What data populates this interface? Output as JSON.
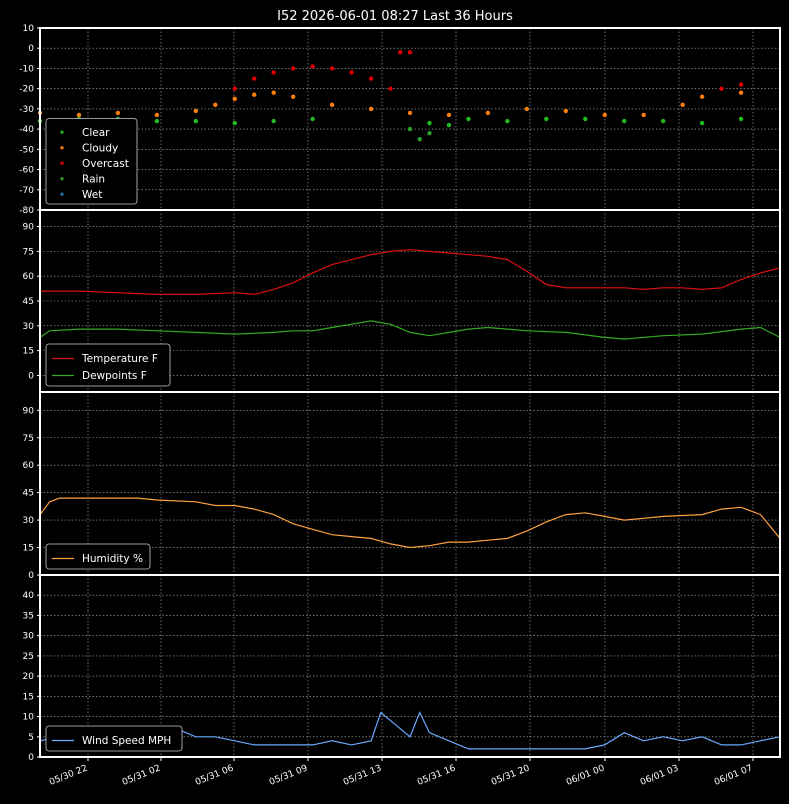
{
  "title": "I52 2026-06-01 08:27 Last 36 Hours",
  "colors": {
    "background": "#000000",
    "frame": "#ffffff",
    "grid": "#b0b0b0",
    "text": "#ffffff"
  },
  "x_ticks": [
    "05/30 22",
    "05/31 02",
    "05/31 06",
    "05/31 09",
    "05/31 13",
    "05/31 16",
    "05/31 20",
    "06/01 00",
    "06/01 03",
    "06/01 07"
  ],
  "chart_data": [
    {
      "type": "scatter",
      "panel": "sky",
      "ylim": [
        -80,
        10
      ],
      "yticks": [
        10,
        0,
        -10,
        -20,
        -30,
        -40,
        -50,
        -60,
        -70,
        -80
      ],
      "legend_position": "lower-left",
      "x_unit": "hours_since_start",
      "series": [
        {
          "name": "Clear",
          "color": "#22bb22",
          "points": [
            [
              0,
              -36
            ],
            [
              2,
              -35
            ],
            [
              4,
              -35
            ],
            [
              6,
              -36
            ],
            [
              8,
              -36
            ],
            [
              10,
              -37
            ],
            [
              12,
              -36
            ],
            [
              14,
              -35
            ],
            [
              20,
              -37
            ],
            [
              21,
              -38
            ],
            [
              22,
              -35
            ],
            [
              24,
              -36
            ],
            [
              26,
              -35
            ],
            [
              28,
              -35
            ],
            [
              30,
              -36
            ],
            [
              32,
              -36
            ],
            [
              34,
              -37
            ],
            [
              36,
              -35
            ]
          ]
        },
        {
          "name": "Cloudy",
          "color": "#ff7f0e",
          "points": [
            [
              0,
              -32
            ],
            [
              2,
              -33
            ],
            [
              4,
              -32
            ],
            [
              6,
              -33
            ],
            [
              8,
              -31
            ],
            [
              9,
              -28
            ],
            [
              10,
              -25
            ],
            [
              11,
              -23
            ],
            [
              12,
              -22
            ],
            [
              13,
              -24
            ],
            [
              15,
              -28
            ],
            [
              17,
              -30
            ],
            [
              19,
              -32
            ],
            [
              21,
              -33
            ],
            [
              23,
              -32
            ],
            [
              25,
              -30
            ],
            [
              27,
              -31
            ],
            [
              29,
              -33
            ],
            [
              31,
              -33
            ],
            [
              33,
              -28
            ],
            [
              34,
              -24
            ],
            [
              36,
              -22
            ]
          ]
        },
        {
          "name": "Overcast",
          "color": "#dd0000",
          "points": [
            [
              10,
              -20
            ],
            [
              11,
              -15
            ],
            [
              12,
              -12
            ],
            [
              13,
              -10
            ],
            [
              14,
              -9
            ],
            [
              15,
              -10
            ],
            [
              16,
              -12
            ],
            [
              17,
              -15
            ],
            [
              18,
              -20
            ],
            [
              18.5,
              -2
            ],
            [
              19,
              -2
            ],
            [
              35,
              -20
            ],
            [
              36,
              -18
            ]
          ]
        },
        {
          "name": "Rain",
          "color": "#2ca02c",
          "points": [
            [
              19,
              -40
            ],
            [
              19.5,
              -45
            ],
            [
              20,
              -42
            ]
          ]
        },
        {
          "name": "Wet",
          "color": "#1f77b4",
          "points": []
        }
      ]
    },
    {
      "type": "line",
      "panel": "temperature",
      "ylim": [
        -10,
        100
      ],
      "yticks": [
        90,
        75,
        60,
        45,
        30,
        15,
        0
      ],
      "legend_position": "lower-left",
      "x_unit": "hours_since_start",
      "series": [
        {
          "name": "Temperature F",
          "color": "#dd1111",
          "points": [
            [
              0,
              51
            ],
            [
              2,
              51
            ],
            [
              4,
              50
            ],
            [
              6,
              49
            ],
            [
              8,
              49
            ],
            [
              10,
              50
            ],
            [
              11,
              49
            ],
            [
              12,
              52
            ],
            [
              13,
              56
            ],
            [
              14,
              62
            ],
            [
              15,
              67
            ],
            [
              16,
              70
            ],
            [
              17,
              73
            ],
            [
              18,
              75
            ],
            [
              19,
              76
            ],
            [
              20,
              75
            ],
            [
              21,
              74
            ],
            [
              22,
              73
            ],
            [
              23,
              72
            ],
            [
              24,
              70
            ],
            [
              25,
              63
            ],
            [
              26,
              55
            ],
            [
              27,
              53
            ],
            [
              28,
              53
            ],
            [
              30,
              53
            ],
            [
              31,
              52
            ],
            [
              32,
              53
            ],
            [
              33,
              53
            ],
            [
              34,
              52
            ],
            [
              35,
              53
            ],
            [
              36,
              58
            ],
            [
              37,
              62
            ],
            [
              38,
              65
            ]
          ]
        },
        {
          "name": "Dewpoints F",
          "color": "#33aa22",
          "points": [
            [
              0,
              23
            ],
            [
              0.5,
              27
            ],
            [
              2,
              28
            ],
            [
              4,
              28
            ],
            [
              6,
              27
            ],
            [
              8,
              26
            ],
            [
              10,
              25
            ],
            [
              12,
              26
            ],
            [
              13,
              27
            ],
            [
              14,
              27
            ],
            [
              15,
              29
            ],
            [
              16,
              31
            ],
            [
              17,
              33
            ],
            [
              18,
              31
            ],
            [
              19,
              26
            ],
            [
              20,
              24
            ],
            [
              21,
              26
            ],
            [
              22,
              28
            ],
            [
              23,
              29
            ],
            [
              24,
              28
            ],
            [
              25,
              27
            ],
            [
              27,
              26
            ],
            [
              29,
              23
            ],
            [
              30,
              22
            ],
            [
              32,
              24
            ],
            [
              34,
              25
            ],
            [
              36,
              28
            ],
            [
              37,
              29
            ],
            [
              38,
              23
            ]
          ]
        }
      ]
    },
    {
      "type": "line",
      "panel": "humidity",
      "ylim": [
        0,
        100
      ],
      "yticks": [
        90,
        75,
        60,
        45,
        30,
        15,
        0
      ],
      "legend_position": "lower-left",
      "x_unit": "hours_since_start",
      "series": [
        {
          "name": "Humidity %",
          "color": "#ffa040",
          "points": [
            [
              0,
              33
            ],
            [
              0.5,
              40
            ],
            [
              1,
              42
            ],
            [
              3,
              42
            ],
            [
              5,
              42
            ],
            [
              6,
              41
            ],
            [
              8,
              40
            ],
            [
              9,
              38
            ],
            [
              10,
              38
            ],
            [
              11,
              36
            ],
            [
              12,
              33
            ],
            [
              13,
              28
            ],
            [
              14,
              25
            ],
            [
              15,
              22
            ],
            [
              16,
              21
            ],
            [
              17,
              20
            ],
            [
              18,
              17
            ],
            [
              19,
              15
            ],
            [
              20,
              16
            ],
            [
              21,
              18
            ],
            [
              22,
              18
            ],
            [
              23,
              19
            ],
            [
              24,
              20
            ],
            [
              25,
              24
            ],
            [
              26,
              29
            ],
            [
              27,
              33
            ],
            [
              28,
              34
            ],
            [
              29,
              32
            ],
            [
              30,
              30
            ],
            [
              31,
              31
            ],
            [
              32,
              32
            ],
            [
              34,
              33
            ],
            [
              35,
              36
            ],
            [
              36,
              37
            ],
            [
              37,
              33
            ],
            [
              38,
              20
            ]
          ]
        }
      ]
    },
    {
      "type": "line",
      "panel": "wind",
      "ylim": [
        0,
        45
      ],
      "yticks": [
        40,
        35,
        30,
        25,
        20,
        15,
        10,
        5,
        0
      ],
      "legend_position": "lower-left",
      "x_unit": "hours_since_start",
      "series": [
        {
          "name": "Wind Speed MPH",
          "color": "#6aaaff",
          "points": [
            [
              0,
              4
            ],
            [
              1,
              5
            ],
            [
              2,
              4
            ],
            [
              3,
              5
            ],
            [
              4,
              5
            ],
            [
              5,
              4
            ],
            [
              6,
              6
            ],
            [
              7,
              7
            ],
            [
              8,
              5
            ],
            [
              9,
              5
            ],
            [
              10,
              4
            ],
            [
              11,
              3
            ],
            [
              12,
              3
            ],
            [
              13,
              3
            ],
            [
              14,
              3
            ],
            [
              15,
              4
            ],
            [
              16,
              3
            ],
            [
              17,
              4
            ],
            [
              17.5,
              11
            ],
            [
              18,
              9
            ],
            [
              19,
              5
            ],
            [
              19.5,
              11
            ],
            [
              20,
              6
            ],
            [
              21,
              4
            ],
            [
              22,
              2
            ],
            [
              23,
              2
            ],
            [
              24,
              2
            ],
            [
              25,
              2
            ],
            [
              26,
              2
            ],
            [
              27,
              2
            ],
            [
              28,
              2
            ],
            [
              29,
              3
            ],
            [
              30,
              6
            ],
            [
              31,
              4
            ],
            [
              32,
              5
            ],
            [
              33,
              4
            ],
            [
              34,
              5
            ],
            [
              35,
              3
            ],
            [
              36,
              3
            ],
            [
              37,
              4
            ],
            [
              38,
              5
            ]
          ]
        }
      ]
    }
  ]
}
